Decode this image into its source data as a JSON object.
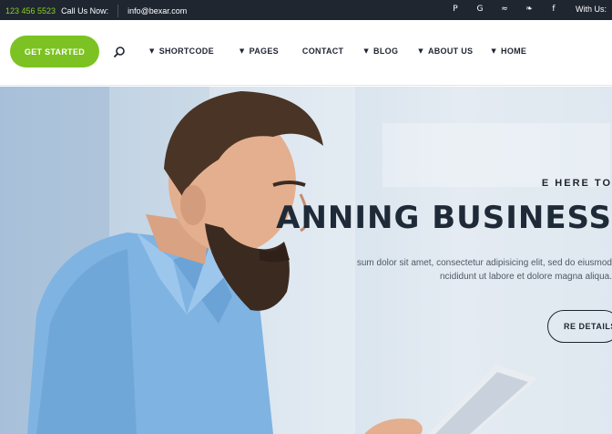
{
  "topbar": {
    "phone_value": "123 456 5523",
    "phone_label": "Call Us Now:",
    "email": "info@bexar.com",
    "social_icons": [
      "pinterest-icon",
      "google-plus-icon",
      "rss-icon",
      "twitter-icon",
      "facebook-icon"
    ],
    "social_glyphs": [
      "P",
      "G",
      "≈",
      "❧",
      "f"
    ],
    "social_label": "With Us:"
  },
  "header": {
    "cta_label": "GET STARTED",
    "nav": [
      {
        "label": "SHORTCODE",
        "caret": true
      },
      {
        "label": "PAGES",
        "caret": true
      },
      {
        "label": "CONTACT",
        "caret": false
      },
      {
        "label": "BLOG",
        "caret": true
      },
      {
        "label": "ABOUT US",
        "caret": true
      },
      {
        "label": "HOME",
        "caret": true
      }
    ]
  },
  "hero": {
    "eyebrow": "E HERE TO",
    "title": "ANNING BUSINESS",
    "line1": "sum dolor sit amet, consectetur adipisicing elit, sed do eiusmod",
    "line2": "ncididunt ut labore et dolore magna aliqua.",
    "button_label": "RE DETAILS"
  },
  "colors": {
    "topbar_bg": "#1f2630",
    "accent_green": "#7cc222",
    "phone_green": "#8bd11f",
    "nav_text": "#1e2530",
    "hero_title": "#1f2a38"
  }
}
